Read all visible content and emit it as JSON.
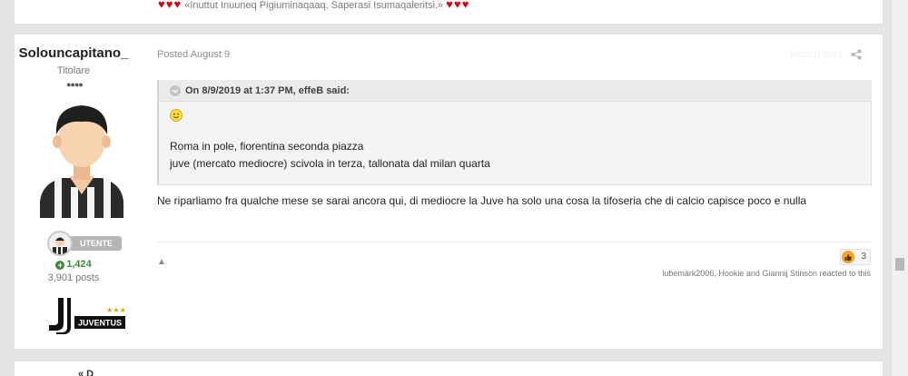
{
  "previous_post": {
    "signature": "«Inuttut Inuuneq Pigiuminaqaaq, Saperasi Isumaqaleritsi.»"
  },
  "post": {
    "author": {
      "name": "Solouncapitano_",
      "title": "Titolare",
      "rank_label": "UTENTE",
      "reputation": "1,424",
      "post_count": "3,901 posts",
      "badge_text": "JUVENTUS"
    },
    "posted": "Posted August 9",
    "report_label": "Report post",
    "quote": {
      "citation": "On 8/9/2019 at 1:37 PM, effeB said:",
      "lines": [
        "Roma in pole, fiorentina seconda piazza",
        "juve (mercato mediocre) scivola in terza, tallonata dal milan quarta"
      ]
    },
    "body": "Ne riparliamo fra qualche mese se sarai ancora qui, di mediocre la Juve ha solo una cosa la tifoseria che di calcio capisce poco e nulla",
    "reaction_count": "3",
    "reacted_text": "lubemark2006, Hookie and Giannij Stinson reacted to this"
  },
  "next_post": {
    "author_fragment": "« D"
  },
  "colors": {
    "reputation": "#3c8a3c",
    "heart": "#d0021b",
    "reaction": "#f5a623"
  }
}
